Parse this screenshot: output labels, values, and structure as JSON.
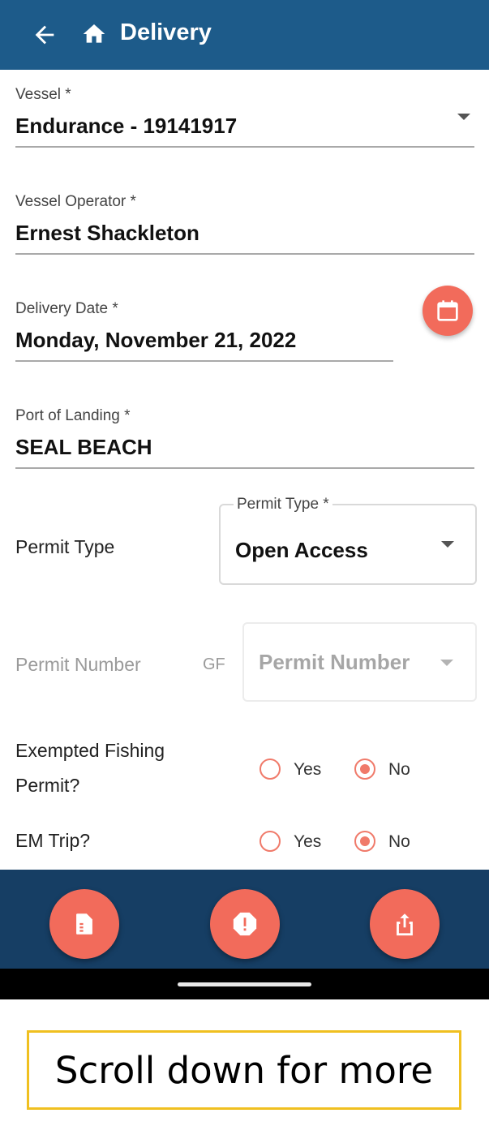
{
  "header": {
    "title": "Delivery",
    "back_icon": "arrow-left-icon",
    "home_icon": "home-icon",
    "background": "#1d5b8a"
  },
  "form": {
    "vessel": {
      "label": "Vessel *",
      "value": "Endurance - 19141917"
    },
    "vessel_operator": {
      "label": "Vessel Operator *",
      "value": "Ernest Shackleton"
    },
    "delivery_date": {
      "label": "Delivery Date *",
      "value": "Monday, November 21, 2022",
      "button_icon": "calendar-icon"
    },
    "port_of_landing": {
      "label": "Port of Landing *",
      "value": "SEAL BEACH"
    },
    "permit_type": {
      "row_label": "Permit Type",
      "box_label": "Permit Type *",
      "value": "Open Access"
    },
    "permit_number": {
      "row_label": "Permit Number",
      "prefix": "GF",
      "placeholder": "Permit Number"
    },
    "exempted_fishing_permit": {
      "label_line1": "Exempted Fishing",
      "label_line2": "Permit?",
      "options": [
        {
          "label": "Yes",
          "selected": false
        },
        {
          "label": "No",
          "selected": true
        }
      ]
    },
    "em_trip": {
      "label": "EM Trip?",
      "options": [
        {
          "label": "Yes",
          "selected": false
        },
        {
          "label": "No",
          "selected": true
        }
      ]
    }
  },
  "bottom_actions": {
    "buttons": [
      {
        "icon": "document-icon"
      },
      {
        "icon": "alert-octagon-icon"
      },
      {
        "icon": "share-upload-icon"
      }
    ],
    "background": "#163e64",
    "accent": "#f26b5b"
  },
  "note": {
    "text": "Scroll down for more",
    "border_color": "#f0c020"
  }
}
